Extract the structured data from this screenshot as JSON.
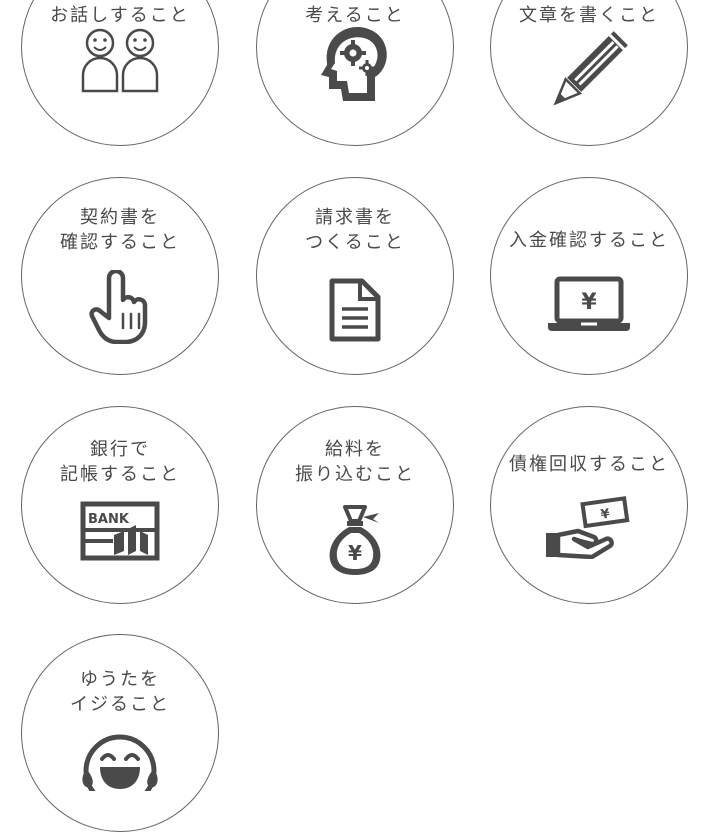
{
  "colors": {
    "icon": "#4a4a4a",
    "ring": "#666666",
    "background": "#ffffff"
  },
  "items": [
    {
      "lines": [
        "お話しすること"
      ],
      "icon": "two-people-icon"
    },
    {
      "lines": [
        "考えること"
      ],
      "icon": "brain-gears-icon"
    },
    {
      "lines": [
        "文章を書くこと"
      ],
      "icon": "pencil-icon"
    },
    {
      "lines": [
        "契約書を",
        "確認すること"
      ],
      "icon": "pointing-hand-icon"
    },
    {
      "lines": [
        "請求書を",
        "つくること"
      ],
      "icon": "document-icon"
    },
    {
      "lines": [
        "入金確認すること"
      ],
      "icon": "laptop-yen-icon",
      "icon_text": "¥"
    },
    {
      "lines": [
        "銀行で",
        "記帳すること"
      ],
      "icon": "bank-passbook-icon",
      "icon_text": "BANK"
    },
    {
      "lines": [
        "給料を",
        "振り込むこと"
      ],
      "icon": "money-bag-icon",
      "icon_text": "¥"
    },
    {
      "lines": [
        "債権回収すること"
      ],
      "icon": "hand-banknote-icon",
      "icon_text": "¥"
    },
    {
      "lines": [
        "ゆうたを",
        "イジること"
      ],
      "icon": "laughing-face-icon"
    }
  ]
}
